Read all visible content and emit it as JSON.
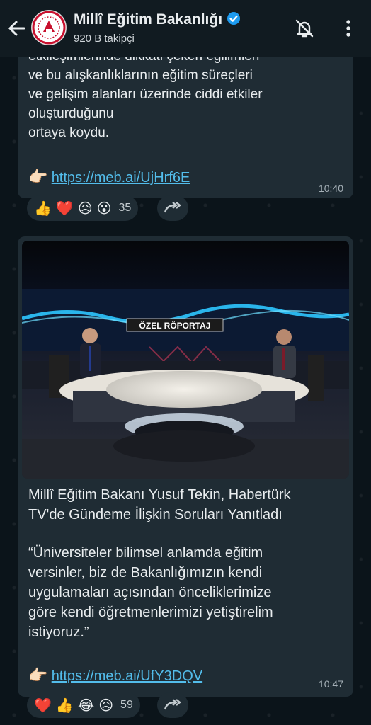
{
  "header": {
    "title": "Millî Eğitim Bakanlığı",
    "followers": "920 B takipçi"
  },
  "messages": [
    {
      "lines": [
        "etkileşimlerinde dikkati çeken eğilimleri",
        "ve bu alışkanlıklarının eğitim süreçleri",
        "ve gelişim alanları üzerinde ciddi etkiler",
        "oluşturduğunu",
        "ortaya koydu."
      ],
      "link_emoji": "👉🏻",
      "link": "https://meb.ai/UjHrf6E",
      "time": "10:40",
      "reactions": [
        "👍",
        "❤️",
        "😥",
        "😮"
      ],
      "reaction_count": "35"
    },
    {
      "image_banner": "ÖZEL RÖPORTAJ",
      "headline_1": "Millî Eğitim Bakanı Yusuf Tekin, Habertürk",
      "headline_2": "TV'de Gündeme İlişkin Soruları Yanıtladı",
      "quote_lines": [
        "“Üniversiteler bilimsel anlamda eğitim",
        "versinler, biz de Bakanlığımızın kendi",
        "uygulamaları açısından önceliklerimize",
        "göre kendi öğretmenlerimizi yetiştirelim",
        "istiyoruz.”"
      ],
      "link_emoji": "👉🏻",
      "link": "https://meb.ai/UfY3DQV",
      "time": "10:47",
      "reactions": [
        "❤️",
        "👍",
        "😂",
        "😥"
      ],
      "reaction_count": "59"
    }
  ],
  "colors": {
    "link": "#53bdeb",
    "bubble": "#1f2c34",
    "header": "#111b21",
    "verified": "#1d9bf0"
  }
}
